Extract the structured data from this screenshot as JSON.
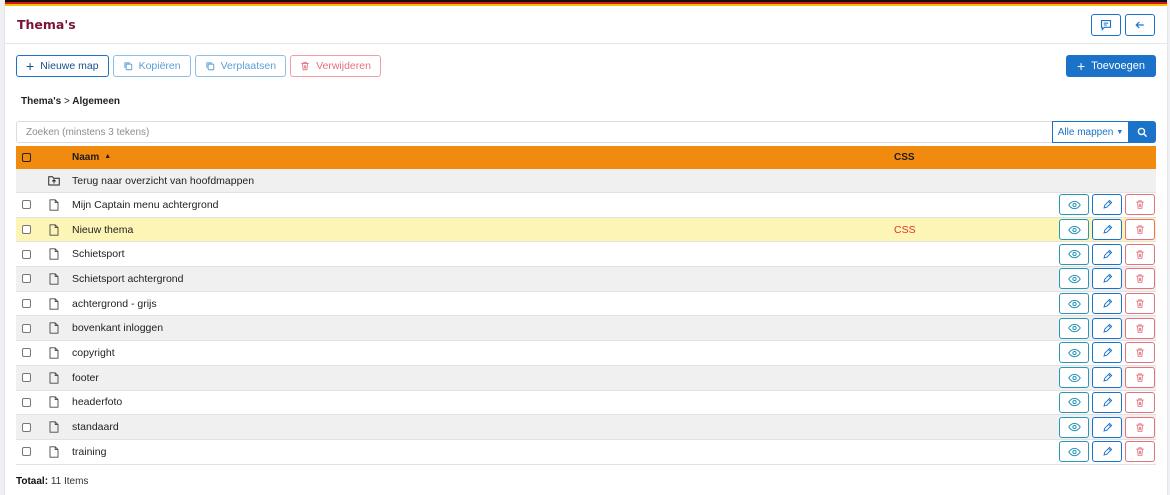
{
  "header": {
    "title": "Thema's",
    "flag_colors": [
      "#111111",
      "#d6141b",
      "#f5c400"
    ]
  },
  "toolbar": {
    "new_folder": "Nieuwe map",
    "copy": "Kopiëren",
    "move": "Verplaatsen",
    "delete": "Verwijderen",
    "add": "Toevoegen"
  },
  "breadcrumb": {
    "root": "Thema's",
    "separator": ">",
    "current": "Algemeen"
  },
  "search": {
    "placeholder": "Zoeken (minstens 3 tekens)",
    "scope": "Alle mappen"
  },
  "table": {
    "col_name": "Naam",
    "col_css": "CSS",
    "back_label": "Terug naar overzicht van hoofdmappen",
    "rows": [
      {
        "name": "Mijn Captain menu achtergrond",
        "css": ""
      },
      {
        "name": "Nieuw thema",
        "css": "CSS"
      },
      {
        "name": "Schietsport",
        "css": ""
      },
      {
        "name": "Schietsport achtergrond",
        "css": ""
      },
      {
        "name": "achtergrond - grijs",
        "css": ""
      },
      {
        "name": "bovenkant inloggen",
        "css": ""
      },
      {
        "name": "copyright",
        "css": ""
      },
      {
        "name": "footer",
        "css": ""
      },
      {
        "name": "headerfoto",
        "css": ""
      },
      {
        "name": "standaard",
        "css": ""
      },
      {
        "name": "training",
        "css": ""
      }
    ]
  },
  "footer": {
    "total_label": "Totaal:",
    "total_value": "11 Items"
  },
  "colors": {
    "accent": "#1a73c9",
    "header_row": "#f18b0f",
    "highlight_row": "#fdf5b5",
    "danger": "#e4727b",
    "title": "#7a1535"
  }
}
